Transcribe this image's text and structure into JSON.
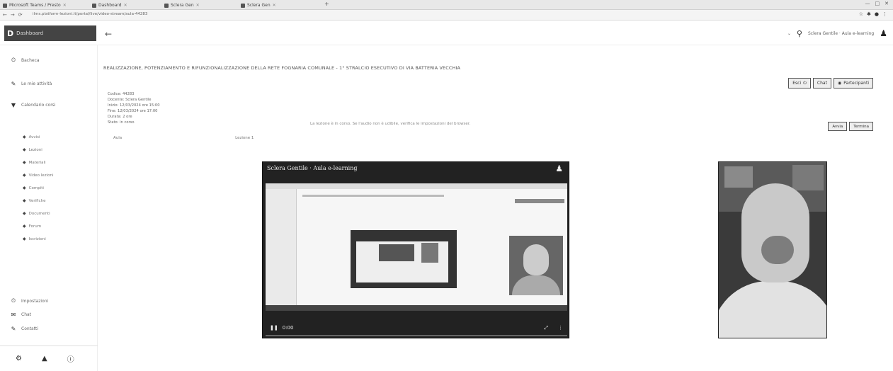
{
  "browser": {
    "tabs": [
      {
        "label": "Microsoft Teams / Presto"
      },
      {
        "label": "Dashboard"
      },
      {
        "label": "Sclera Gen"
      },
      {
        "label": "Sclera Gen"
      }
    ],
    "new_tab": "+",
    "window_controls": [
      "—",
      "□",
      "✕"
    ],
    "nav": [
      "←",
      "→",
      "⟳"
    ],
    "url": "ilms.platform-lezioni.it/portal/live/video-stream/aula-44283"
  },
  "app": {
    "logo_short": "D",
    "logo_text": "Dashboard",
    "back": "←",
    "header_text": "Sclera Gentile · Aula e-learning",
    "search_icon": "search-icon",
    "user_icon": "user-icon"
  },
  "sidebar": {
    "items": [
      {
        "icon": "⏲",
        "label": "Bacheca"
      },
      {
        "icon": "✎",
        "label": "Le mie attività"
      },
      {
        "icon": "▼",
        "label": "Calendario corsi"
      }
    ],
    "sub_items": [
      {
        "label": "Avvisi"
      },
      {
        "label": "Lezioni"
      },
      {
        "label": "Materiali"
      },
      {
        "label": "Video lezioni"
      },
      {
        "label": "Compiti"
      },
      {
        "label": "Verifiche"
      },
      {
        "label": "Documenti"
      },
      {
        "label": "Forum"
      },
      {
        "label": "Iscrizioni"
      }
    ],
    "footer_items": [
      {
        "icon": "⏲",
        "label": "Impostazioni"
      },
      {
        "icon": "✉",
        "label": "Chat"
      },
      {
        "icon": "✎",
        "label": "Contatti"
      }
    ],
    "bottom_icons": [
      "⚙",
      "▲",
      "ⓘ"
    ]
  },
  "main": {
    "title": "REALIZZAZIONE, POTENZIAMENTO E RIFUNZIONALIZZAZIONE DELLA RETE FOGNARIA COMUNALE - 1° STRALCIO ESECUTIVO DI VIA BATTERIA VECCHIA",
    "buttons": [
      "Esci",
      "Chat",
      "Partecipanti"
    ],
    "meta": [
      "Codice: 44283",
      "Docente: Sclera Gentile",
      "Inizio: 12/03/2024 ore 15:00",
      "Fine: 12/03/2024 ore 17:00",
      "Durata: 2 ore",
      "Stato: in corso"
    ],
    "notice": "La lezione è in corso. Se l'audio non è udibile, verifica le impostazioni del browser.",
    "small_buttons": [
      "Avvia",
      "Termina"
    ],
    "pager_left": "Aula",
    "pager_right": "Lezione 1"
  },
  "share": {
    "title": "Sclera Gentile · Aula e-learning",
    "icon": "presenter-icon",
    "time": "0:00",
    "controls_right": [
      "⤢",
      "⋮"
    ]
  }
}
